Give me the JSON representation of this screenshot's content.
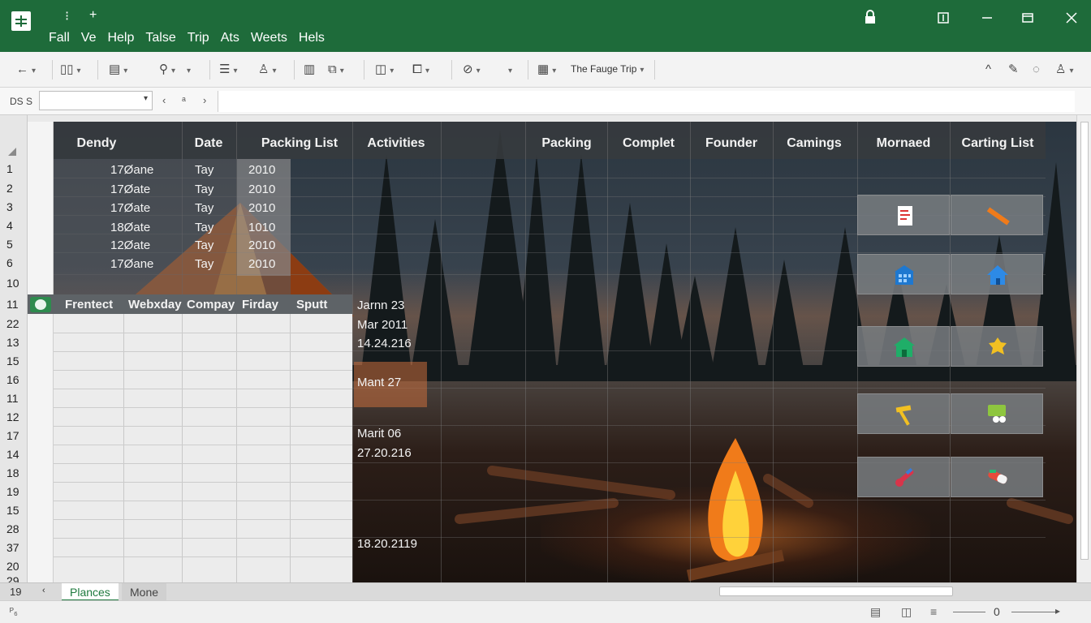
{
  "titlebar": {
    "menu": [
      "Fall",
      "Ve",
      "Help",
      "Talse",
      "Trip",
      "Ats",
      "Weets",
      "Hels"
    ],
    "quick_access": [
      "⁝",
      "+"
    ],
    "window_icons": [
      "lock-icon",
      "restore-icon",
      "minimize-icon",
      "maximize-icon",
      "close-icon"
    ]
  },
  "ribbon": {
    "document_label": "The Fauge Trip"
  },
  "formula_bar": {
    "cell_label": "DS S",
    "name_box_value": "",
    "nav": [
      "‹",
      "ᵃ",
      "›"
    ]
  },
  "grid": {
    "column_headers": [
      "Dendy",
      "Date",
      "Packing List",
      "Activities",
      "Packing",
      "Complet",
      "Founder",
      "Camings",
      "Mornaed",
      "Carting List"
    ],
    "row_numbers": [
      "1",
      "2",
      "3",
      "4",
      "5",
      "6",
      "10",
      "11",
      "22",
      "13",
      "15",
      "16",
      "11",
      "12",
      "17",
      "14",
      "18",
      "19",
      "15",
      "28",
      "37",
      "20",
      "29"
    ],
    "upper_rows": [
      {
        "dendy": "17Øane",
        "date": "Tay",
        "packing": "2010"
      },
      {
        "dendy": "17Øate",
        "date": "Tay",
        "packing": "2010"
      },
      {
        "dendy": "17Øate",
        "date": "Tay",
        "packing": "2010"
      },
      {
        "dendy": "18Øate",
        "date": "Tay",
        "packing": "1010"
      },
      {
        "dendy": "12Øate",
        "date": "Tay",
        "packing": "2010"
      },
      {
        "dendy": "17Øane",
        "date": "Tay",
        "packing": "2010"
      }
    ],
    "lower_headers": [
      "Frentect",
      "Webxday",
      "Compay",
      "Firday",
      "Sputt"
    ],
    "activity_dates": [
      "Jarnn 23",
      "Mar 2011",
      "14.24.216",
      "Mant 27",
      "Marit 06",
      "27.20.216",
      "18.20.2119"
    ]
  },
  "sheet_tabs": {
    "row_label": "19",
    "tabs": [
      "Plances",
      "Mone"
    ],
    "active_tab": "Plances"
  },
  "status": {
    "left": "ᴾ₆",
    "zoom": "0"
  },
  "colors": {
    "titlebar": "#1e6b3a",
    "accent": "#1e7a3e"
  }
}
